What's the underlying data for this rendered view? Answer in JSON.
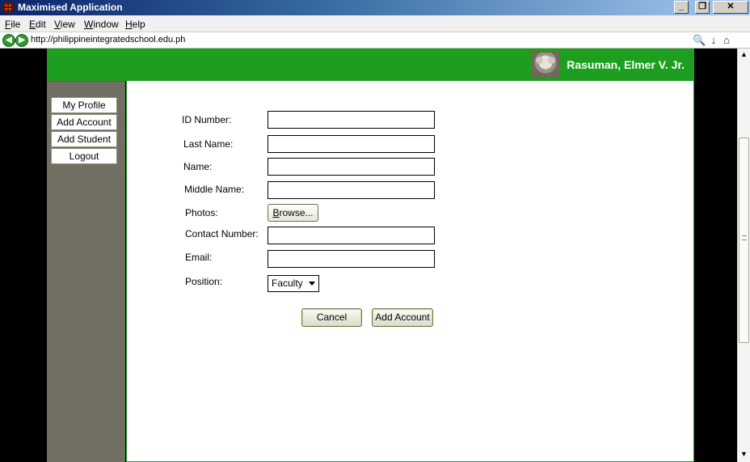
{
  "window": {
    "title": "Maximised Application",
    "minimize_icon": "minimize-icon",
    "restore_icon": "restore-icon",
    "close_icon": "close-icon"
  },
  "menu": {
    "items": [
      {
        "mnemonic": "F",
        "rest": "ile"
      },
      {
        "mnemonic": "E",
        "rest": "dit"
      },
      {
        "mnemonic": "V",
        "rest": "iew"
      },
      {
        "mnemonic": "W",
        "rest": "indow"
      },
      {
        "mnemonic": "H",
        "rest": "elp"
      }
    ]
  },
  "address": {
    "url": "http://philippineintegratedschool.edu.ph"
  },
  "header": {
    "user_name": "Rasuman, Elmer V. Jr."
  },
  "sidebar": {
    "items": [
      "My Profile",
      "Add Account",
      "Add Student",
      "Logout"
    ]
  },
  "form": {
    "id_label": "ID Number:",
    "last_name_label": "Last Name:",
    "name_label": "Name:",
    "middle_name_label": "Middle Name:",
    "photos_label": "Photos:",
    "browse_mnemonic": "B",
    "browse_rest": "rowse...",
    "contact_label": "Contact Number:",
    "email_label": "Email:",
    "position_label": "Position:",
    "position_value": "Faculty",
    "id_value": "",
    "last_name_value": "",
    "name_value": "",
    "middle_name_value": "",
    "contact_value": "",
    "email_value": "",
    "cancel_label": "Cancel",
    "submit_label": "Add Account"
  }
}
